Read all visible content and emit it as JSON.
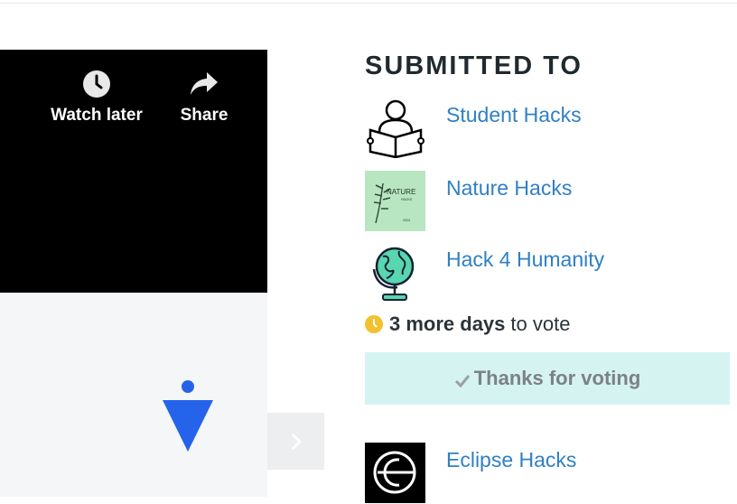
{
  "video": {
    "watch_later_label": "Watch later",
    "share_label": "Share",
    "icons": [
      "clock-icon",
      "share-arrow-icon"
    ]
  },
  "marker": {
    "icon": "location-marker-icon",
    "color": "#2563eb"
  },
  "next_arrow": {
    "icon": "chevron-right-icon"
  },
  "submitted": {
    "heading": "SUBMITTED TO",
    "hackathons": [
      {
        "name": "Student Hacks",
        "icon": "student-reading-icon"
      },
      {
        "name": "Nature Hacks",
        "logo_text": "NATURE",
        "logo_sub": "HACKS",
        "logo_year": "2024",
        "thumb_bg": "#b8e6c1"
      },
      {
        "name": "Hack 4 Humanity",
        "icon": "globe-icon"
      },
      {
        "name": "Eclipse Hacks",
        "icon": "eclipse-logo-icon"
      }
    ]
  },
  "voting": {
    "days_bold": "3 more days",
    "days_rest": "to vote",
    "thanks_label": "Thanks for voting"
  },
  "colors": {
    "link": "#2f80c5",
    "vote_bg": "#d5f3f1",
    "clock": "#f2c12e"
  }
}
